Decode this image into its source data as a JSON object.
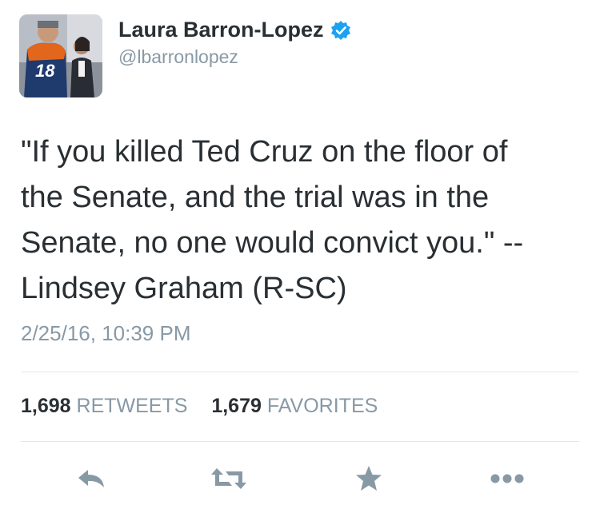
{
  "user": {
    "display_name": "Laura Barron-Lopez",
    "handle": "@lbarronlopez",
    "verified": true,
    "jersey_number": "18"
  },
  "tweet": {
    "text": "\"If you killed Ted Cruz on the floor of\nthe Senate, and the trial was in the\nSenate, no one would convict you.\" --\nLindsey Graham (R-SC)",
    "timestamp": "2/25/16, 10:39 PM"
  },
  "stats": {
    "retweets_count": "1,698",
    "retweets_label": "RETWEETS",
    "favorites_count": "1,679",
    "favorites_label": "FAVORITES"
  },
  "actions": {
    "reply_icon": "reply-icon",
    "retweet_icon": "retweet-icon",
    "favorite_icon": "star-icon",
    "more_icon": "more-icon"
  },
  "colors": {
    "text": "#292f33",
    "muted": "#8899a6",
    "verified": "#1da1f2",
    "divider": "#e1e8ed",
    "icon": "#8899a6"
  }
}
